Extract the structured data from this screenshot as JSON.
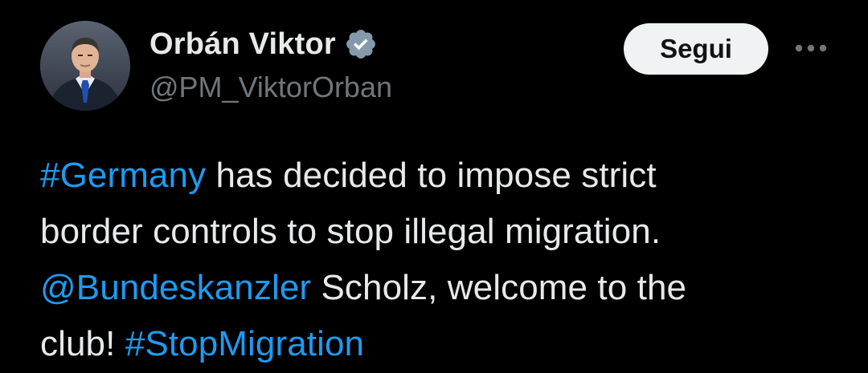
{
  "author": {
    "display_name": "Orbán Viktor",
    "handle": "@PM_ViktorOrban",
    "verified": true,
    "avatar_icon": "profile-photo"
  },
  "actions": {
    "follow_label": "Segui",
    "more_icon": "more-horizontal-icon"
  },
  "tweet": {
    "lines": [
      {
        "parts": [
          {
            "text": "#Germany",
            "type": "hashtag"
          },
          {
            "text": " has decided to impose strict",
            "type": "text"
          }
        ]
      },
      {
        "parts": [
          {
            "text": "border controls to stop illegal migration.",
            "type": "text"
          }
        ]
      },
      {
        "parts": [
          {
            "text": "@Bundeskanzler",
            "type": "mention"
          },
          {
            "text": " Scholz, welcome to the",
            "type": "text"
          }
        ]
      },
      {
        "parts": [
          {
            "text": "club! ",
            "type": "text"
          },
          {
            "text": "#StopMigration",
            "type": "hashtag"
          }
        ]
      }
    ]
  },
  "colors": {
    "background": "#000000",
    "primary_text": "#e7e9ea",
    "secondary_text": "#71767b",
    "link": "#1d9bf0",
    "follow_button_bg": "#eff3f4",
    "verified_badge": "#829aab"
  }
}
